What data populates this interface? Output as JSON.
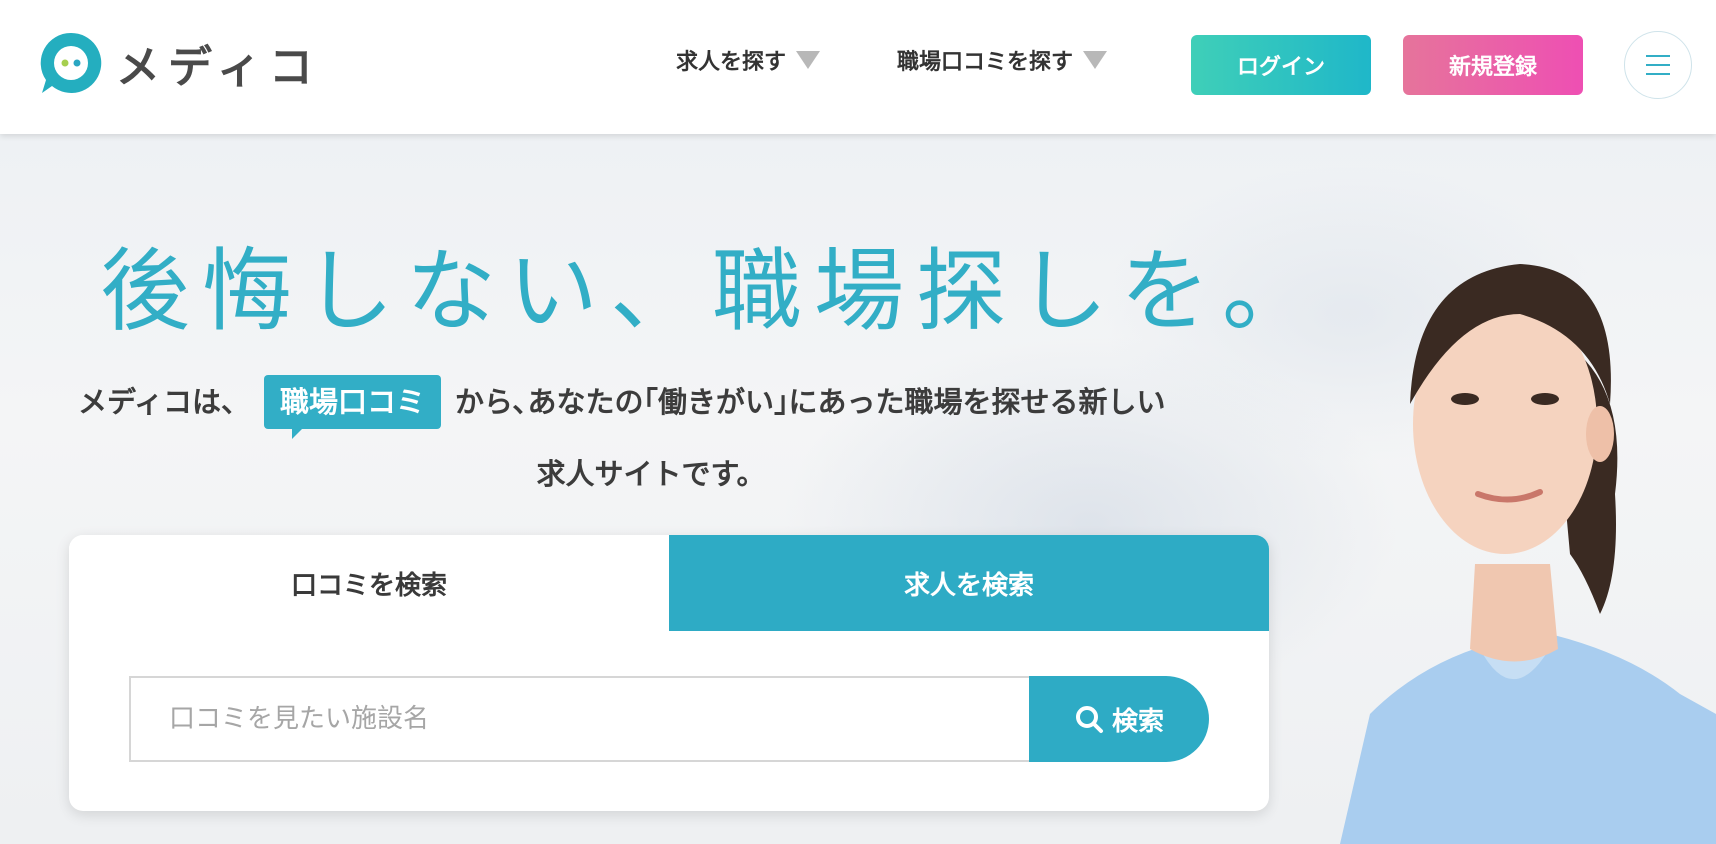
{
  "header": {
    "logo_text": "メディコ",
    "nav": [
      {
        "label": "求人を探す"
      },
      {
        "label": "職場口コミを探す"
      }
    ],
    "login_label": "ログイン",
    "register_label": "新規登録"
  },
  "hero": {
    "headline": "後悔しない、職場探しを。",
    "lead_before": "メディコは、",
    "lead_tag": "職場口コミ",
    "lead_after": "から､あなたの｢働きがい｣にあった職場を探せる新しい",
    "lead_line2": "求人サイトです。"
  },
  "search": {
    "tabs": [
      {
        "label": "口コミを検索",
        "active": false
      },
      {
        "label": "求人を検索",
        "active": true
      }
    ],
    "placeholder": "口コミを見たい施設名",
    "button_label": "検索"
  },
  "colors": {
    "brand_teal": "#32aec6",
    "login_gradient": "#3fcfb8 → #1fb7c9",
    "register_gradient": "#e6749b → #ee4fb3"
  }
}
